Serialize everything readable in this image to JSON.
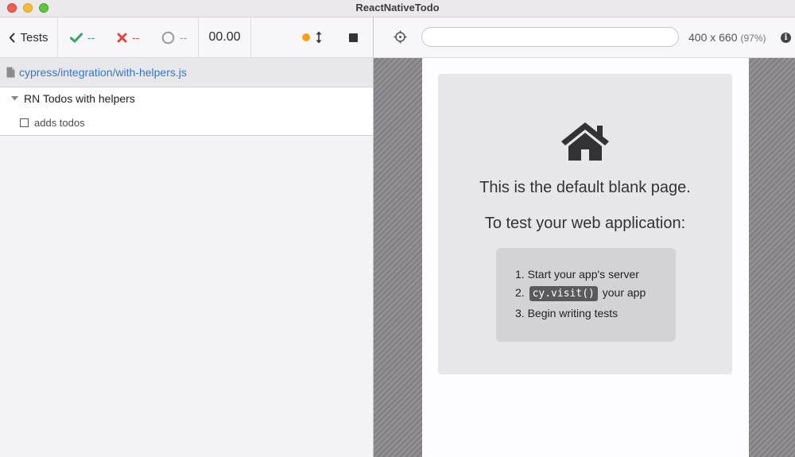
{
  "window": {
    "title": "ReactNativeTodo"
  },
  "reporter": {
    "tests_label": "Tests",
    "passed": "--",
    "failed": "--",
    "pending": "--",
    "duration": "00.00",
    "spec_path": "cypress/integration/with-helpers.js",
    "suite_title": "RN Todos with helpers",
    "test_title": "adds todos"
  },
  "aut": {
    "url": "",
    "viewport_size": "400 x 660",
    "viewport_scale": "(97%)",
    "info_glyph": "i"
  },
  "blank_page": {
    "line1": "This is the default blank page.",
    "line2": "To test your web application:",
    "step1": "1. Start your app's server",
    "step2_prefix": "2. ",
    "step2_code": "cy.visit()",
    "step2_suffix": " your app",
    "step3": "3. Begin writing tests"
  },
  "colors": {
    "pass": "#2fa46a",
    "fail": "#e04040",
    "pending": "#9a9a9d",
    "link": "#3378c4",
    "auto_scroll_dot": "#f7a21b"
  },
  "icons": [
    "chevron-left-icon",
    "check-icon",
    "x-icon",
    "circle-icon",
    "auto-scroll-icon",
    "stop-icon",
    "file-icon",
    "caret-down-icon",
    "crosshair-icon",
    "info-icon",
    "house-icon"
  ]
}
